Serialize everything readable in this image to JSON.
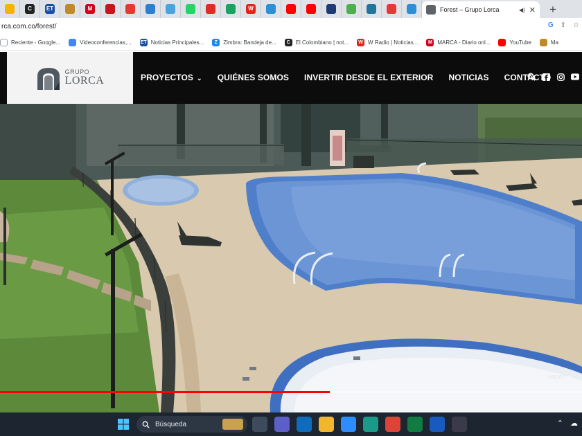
{
  "browser": {
    "tab_favicons": [
      {
        "name": "tab-favicon-1",
        "glyph": "",
        "color": "#f4b400"
      },
      {
        "name": "tab-favicon-2",
        "glyph": "C",
        "color": "#222222"
      },
      {
        "name": "tab-favicon-3",
        "glyph": "ET",
        "color": "#1a4fa3"
      },
      {
        "name": "tab-favicon-4",
        "glyph": "",
        "color": "#c08a2a"
      },
      {
        "name": "tab-favicon-5",
        "glyph": "M",
        "color": "#d0021b"
      },
      {
        "name": "tab-favicon-6",
        "glyph": "",
        "color": "#c4161c"
      },
      {
        "name": "tab-favicon-7",
        "glyph": "",
        "color": "#e03c31"
      },
      {
        "name": "tab-favicon-8",
        "glyph": "",
        "color": "#2f7fd0"
      },
      {
        "name": "tab-favicon-9",
        "glyph": "",
        "color": "#4aa3df"
      },
      {
        "name": "tab-favicon-10",
        "glyph": "",
        "color": "#25d366"
      },
      {
        "name": "tab-favicon-11",
        "glyph": "",
        "color": "#d93025"
      },
      {
        "name": "tab-favicon-12",
        "glyph": "",
        "color": "#1aa260"
      },
      {
        "name": "tab-favicon-13",
        "glyph": "W",
        "color": "#e3241b"
      },
      {
        "name": "tab-favicon-14",
        "glyph": "",
        "color": "#2d8fd5"
      },
      {
        "name": "tab-favicon-15",
        "glyph": "",
        "color": "#ff0000"
      },
      {
        "name": "tab-favicon-16",
        "glyph": "",
        "color": "#ff0000"
      },
      {
        "name": "tab-favicon-17",
        "glyph": "",
        "color": "#1f3b73"
      },
      {
        "name": "tab-favicon-18",
        "glyph": "",
        "color": "#4caf50"
      },
      {
        "name": "tab-favicon-19",
        "glyph": "",
        "color": "#21759b"
      },
      {
        "name": "tab-favicon-20",
        "glyph": "",
        "color": "#e53935"
      },
      {
        "name": "tab-favicon-21",
        "glyph": "",
        "color": "#2d8fd5"
      }
    ],
    "active_tab_title": "Forest – Grupo Lorca",
    "new_tab_label": "+",
    "url": "rca.com.co/forest/",
    "bookmarks": [
      {
        "label": "Reciente - Google...",
        "glyph": "",
        "color": "#ffffff"
      },
      {
        "label": "Videoconferencias,...",
        "glyph": "",
        "color": "#4285f4"
      },
      {
        "label": "Noticias Principales...",
        "glyph": "ET",
        "color": "#1a4fa3"
      },
      {
        "label": "Zimbra: Bandeja de...",
        "glyph": "Z",
        "color": "#1e88e5"
      },
      {
        "label": "El Colombiano | not...",
        "glyph": "C",
        "color": "#222222"
      },
      {
        "label": "W Radio | Noticias...",
        "glyph": "W",
        "color": "#e3241b"
      },
      {
        "label": "MARCA - Diario onl...",
        "glyph": "M",
        "color": "#d0021b"
      },
      {
        "label": "YouTube",
        "glyph": "",
        "color": "#ff0000"
      },
      {
        "label": "Ma",
        "glyph": "",
        "color": "#c08a2a"
      }
    ]
  },
  "site": {
    "logo_small": "GRUPO",
    "logo_big": "LORCA",
    "nav": [
      {
        "label": "PROYECTOS",
        "has_caret": true
      },
      {
        "label": "QUIÉNES SOMOS",
        "has_caret": false
      },
      {
        "label": "INVERTIR DESDE EL EXTERIOR",
        "has_caret": false
      },
      {
        "label": "NOTICIAS",
        "has_caret": false
      },
      {
        "label": "CONTACTO",
        "has_caret": false
      }
    ],
    "social_icons": [
      "search-icon",
      "facebook-icon",
      "instagram-icon",
      "youtube-icon"
    ]
  },
  "video": {
    "progress": 0.567,
    "watermark": "wapon"
  },
  "taskbar": {
    "search_label": "Búsqueda",
    "apps": [
      {
        "name": "taskview-icon",
        "color": "#3d4b5c"
      },
      {
        "name": "teams-chat-icon",
        "color": "#5b5fc7"
      },
      {
        "name": "outlook-icon",
        "color": "#0f6cbd"
      },
      {
        "name": "file-explorer-icon",
        "color": "#f2b52e"
      },
      {
        "name": "zoom-icon",
        "color": "#2d8cff"
      },
      {
        "name": "edge-icon",
        "color": "#1a9b8a"
      },
      {
        "name": "chrome-icon",
        "color": "#db4437"
      },
      {
        "name": "excel-icon",
        "color": "#107c41"
      },
      {
        "name": "word-icon",
        "color": "#185abd"
      },
      {
        "name": "media-player-icon",
        "color": "#3a3a4a"
      }
    ]
  }
}
